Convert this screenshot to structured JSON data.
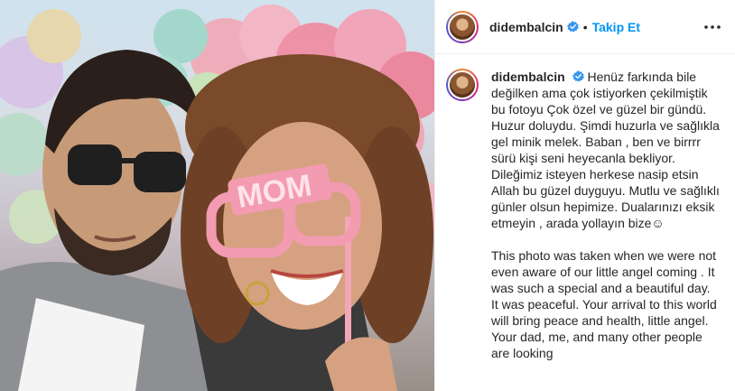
{
  "account": {
    "username": "didembalcin",
    "verified": true,
    "separator": "•",
    "follow_label": "Takip Et"
  },
  "icons": {
    "verified": "verified-badge-icon",
    "more": "more-options-icon",
    "accent": "#0095f6",
    "verified_color": "#3897f0"
  },
  "photo": {
    "glasses_text": "MOM"
  },
  "caption": {
    "username": "didembalcin",
    "turkish": "Henüz farkında bile değilken ama çok istiyorken çekilmiştik bu fotoyu Çok özel ve güzel bir gündü. Huzur doluydu. Şimdi huzurla ve sağlıkla gel minik melek. Baban , ben ve birrrr sürü kişi seni heyecanla bekliyor. Dileğimiz isteyen herkese nasip etsin Allah bu güzel duyguyu. Mutlu ve sağlıklı günler olsun hepimize. Dualarınızı eksik etmeyin , arada yollayın bize☺",
    "english": "This photo was taken when we were not even aware of our little angel coming . It was such a special and a beautiful day. It was peaceful. Your arrival to this world will bring peace and health, little angel. Your dad, me, and many other people are looking"
  }
}
